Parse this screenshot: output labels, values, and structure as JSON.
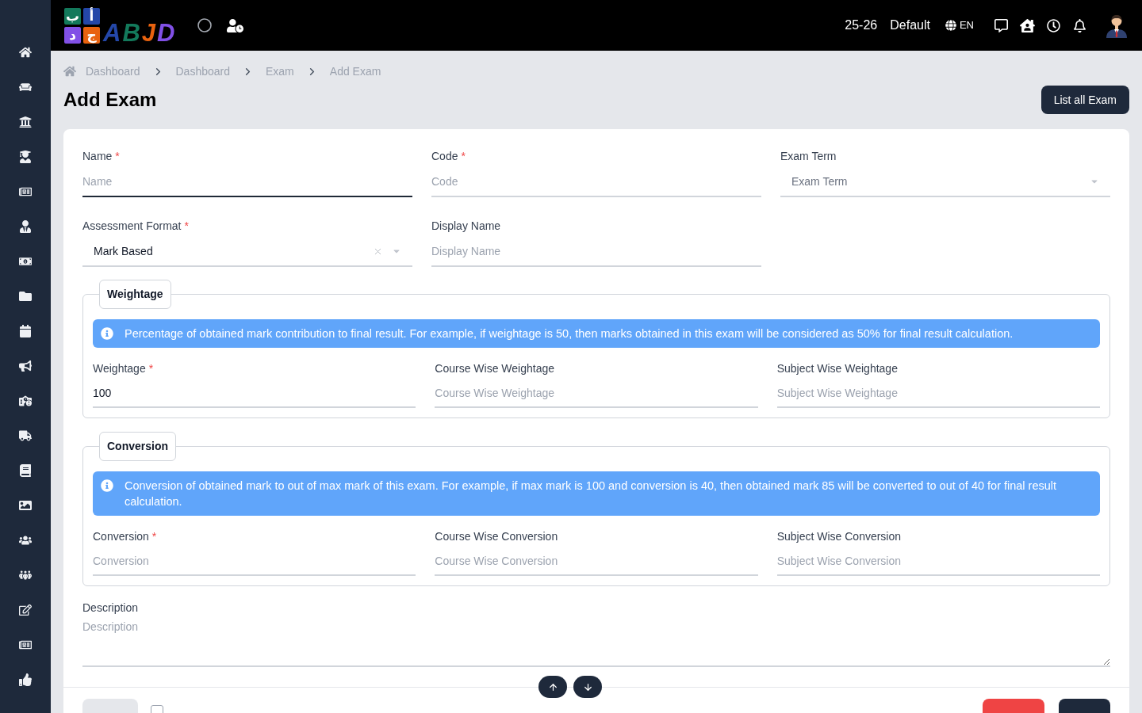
{
  "header": {
    "logo": {
      "tile_rows": [
        [
          {
            "letter": "أ",
            "color": "#2447a8"
          },
          {
            "letter": "ب",
            "color": "#13795b"
          }
        ],
        [
          {
            "letter": "ج",
            "color": "#e8620f"
          },
          {
            "letter": "د",
            "color": "#8150e6"
          }
        ]
      ],
      "wordmark": [
        {
          "letter": "A",
          "color": "#2447a8"
        },
        {
          "letter": "B",
          "color": "#13795b"
        },
        {
          "letter": "J",
          "color": "#e8620f"
        },
        {
          "letter": "D",
          "color": "#8150e6"
        }
      ]
    },
    "session": "25-26",
    "profile": "Default",
    "language": "EN"
  },
  "breadcrumb": [
    "Dashboard",
    "Dashboard",
    "Exam",
    "Add Exam"
  ],
  "page": {
    "title": "Add Exam",
    "action": "List all Exam"
  },
  "form": {
    "fields": [
      {
        "kind": "text",
        "label": "Name",
        "required_mark": "*",
        "placeholder": "Name",
        "focused": true
      },
      {
        "kind": "text",
        "label": "Code",
        "required_mark": "*",
        "placeholder": "Code",
        "focused": false
      },
      {
        "kind": "select",
        "label": "Exam Term",
        "placeholder": "Exam Term",
        "focused": false
      },
      {
        "kind": "select",
        "label": "Assessment Format",
        "required_mark": "*",
        "value": "Mark Based",
        "clearable": true,
        "focused": false
      },
      {
        "kind": "text",
        "label": "Display Name",
        "placeholder": "Display Name",
        "focused": false
      }
    ],
    "groups": [
      {
        "legend": "Weightage",
        "info": "Percentage of obtained mark contribution to final result. For example, if weightage is 50, then marks obtained in this exam will be considered as 50% for final result calculation.",
        "fields": [
          {
            "kind": "text",
            "label": "Weightage",
            "required_mark": "*",
            "value": "100",
            "focused": false
          },
          {
            "kind": "text",
            "label": "Course Wise Weightage",
            "placeholder": "Course Wise Weightage",
            "focused": false
          },
          {
            "kind": "text",
            "label": "Subject Wise Weightage",
            "placeholder": "Subject Wise Weightage",
            "focused": false
          }
        ]
      },
      {
        "legend": "Conversion",
        "info": "Conversion of obtained mark to out of max mark of this exam. For example, if max mark is 100 and conversion is 40, then obtained mark 85 will be converted to out of 40 for final result calculation.",
        "fields": [
          {
            "kind": "text",
            "label": "Conversion",
            "required_mark": "*",
            "placeholder": "Conversion",
            "focused": false
          },
          {
            "kind": "text",
            "label": "Course Wise Conversion",
            "placeholder": "Course Wise Conversion",
            "focused": false
          },
          {
            "kind": "text",
            "label": "Subject Wise Conversion",
            "placeholder": "Subject Wise Conversion",
            "focused": false
          }
        ]
      }
    ],
    "description": {
      "label": "Description",
      "placeholder": "Description",
      "focused": false
    }
  },
  "footer": {
    "left_button": {
      "kind": "secondary"
    },
    "keep_adding": {
      "checked": false
    },
    "right_buttons": [
      {
        "kind": "danger"
      },
      {
        "kind": "primary"
      }
    ]
  }
}
